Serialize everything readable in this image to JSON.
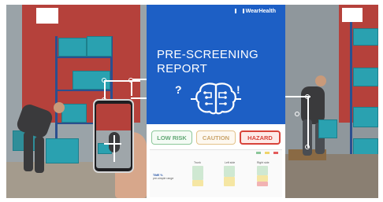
{
  "brand": {
    "name": "WearHealth",
    "logo_icon": "wearhealth-logo-icon"
  },
  "report": {
    "title_line1": "PRE-SCREENING",
    "title_line2": "REPORT",
    "question_mark": "?",
    "exclamation": "!",
    "brain_icon": "brain-circuit-icon"
  },
  "risk_levels": {
    "low": "LOW RISK",
    "caution": "CAUTION",
    "hazard": "HAZARD",
    "selected": "hazard"
  },
  "table": {
    "heading": "",
    "legend": [
      {
        "label": "",
        "color": "#8cc79a"
      },
      {
        "label": "",
        "color": "#f0d46a"
      },
      {
        "label": "",
        "color": "#e35b5b"
      }
    ],
    "columns": [
      "Trunk",
      "Left side",
      "Right side"
    ],
    "row_label_line1": "TIME %",
    "row_label_line2": "pre-simple range",
    "cell_values": [
      "",
      "",
      "",
      "",
      "",
      ""
    ],
    "score_label": ""
  },
  "colors": {
    "report_blue": "#1d5fc5",
    "hazard_red": "#d8433a",
    "low_green": "#8cc79a",
    "caution_amber": "#e3c28a"
  }
}
